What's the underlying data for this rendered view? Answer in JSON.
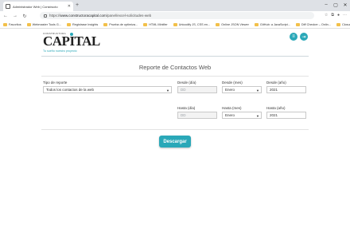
{
  "browser": {
    "tab_title": "Administrador Web | Constructo",
    "new_tab_symbol": "+",
    "url_prefix": "https://",
    "url_host": "www.constructoracapital.com",
    "url_path": "/panel/excel-solicitudes-web",
    "window_controls": [
      "–",
      "▢",
      "✕"
    ],
    "bookmarks": [
      "Favoritos",
      "Webmaster Tools G...",
      "Registrase Insights",
      "Prueba de optimiza...",
      "HTML Minifier",
      "Unicodify JS, CSS en...",
      "Online JSON Viewer",
      "GitHub: a JavaScript...",
      "Diff Checker – Onlin...",
      "Closure Compiler S..."
    ]
  },
  "header": {
    "logo_small": "CONSTRUCTORA",
    "logo_main": "CAPITAL",
    "logo_tag": "Tu sueño nuestro proyecto"
  },
  "main": {
    "title": "Reporte de Contactos Web",
    "tipo_label": "Tipo de reporte",
    "tipo_value": "Todos los contactos de la web",
    "desde_dia_label": "Desde (día)",
    "desde_dia_placeholder": "DD",
    "desde_mes_label": "Desde (mes)",
    "desde_mes_value": "Enero",
    "desde_anio_label": "Desde (año)",
    "desde_anio_value": "2021",
    "hasta_dia_label": "Hasta (día)",
    "hasta_dia_placeholder": "DD",
    "hasta_mes_label": "Hasta (mes)",
    "hasta_mes_value": "Enero",
    "hasta_anio_label": "Hasta (año)",
    "hasta_anio_value": "2021",
    "download_label": "Descargar"
  },
  "colors": {
    "accent": "#2aa8b8"
  }
}
